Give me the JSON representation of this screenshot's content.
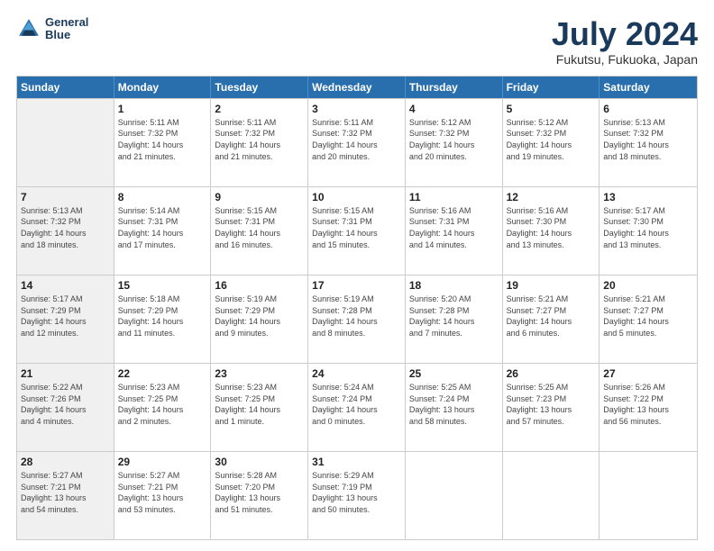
{
  "logo": {
    "line1": "General",
    "line2": "Blue"
  },
  "title": "July 2024",
  "subtitle": "Fukutsu, Fukuoka, Japan",
  "calendar": {
    "headers": [
      "Sunday",
      "Monday",
      "Tuesday",
      "Wednesday",
      "Thursday",
      "Friday",
      "Saturday"
    ],
    "rows": [
      [
        {
          "day": "",
          "info": "",
          "shaded": true
        },
        {
          "day": "1",
          "info": "Sunrise: 5:11 AM\nSunset: 7:32 PM\nDaylight: 14 hours\nand 21 minutes.",
          "shaded": false
        },
        {
          "day": "2",
          "info": "Sunrise: 5:11 AM\nSunset: 7:32 PM\nDaylight: 14 hours\nand 21 minutes.",
          "shaded": false
        },
        {
          "day": "3",
          "info": "Sunrise: 5:11 AM\nSunset: 7:32 PM\nDaylight: 14 hours\nand 20 minutes.",
          "shaded": false
        },
        {
          "day": "4",
          "info": "Sunrise: 5:12 AM\nSunset: 7:32 PM\nDaylight: 14 hours\nand 20 minutes.",
          "shaded": false
        },
        {
          "day": "5",
          "info": "Sunrise: 5:12 AM\nSunset: 7:32 PM\nDaylight: 14 hours\nand 19 minutes.",
          "shaded": false
        },
        {
          "day": "6",
          "info": "Sunrise: 5:13 AM\nSunset: 7:32 PM\nDaylight: 14 hours\nand 18 minutes.",
          "shaded": false
        }
      ],
      [
        {
          "day": "7",
          "info": "Sunrise: 5:13 AM\nSunset: 7:32 PM\nDaylight: 14 hours\nand 18 minutes.",
          "shaded": true
        },
        {
          "day": "8",
          "info": "Sunrise: 5:14 AM\nSunset: 7:31 PM\nDaylight: 14 hours\nand 17 minutes.",
          "shaded": false
        },
        {
          "day": "9",
          "info": "Sunrise: 5:15 AM\nSunset: 7:31 PM\nDaylight: 14 hours\nand 16 minutes.",
          "shaded": false
        },
        {
          "day": "10",
          "info": "Sunrise: 5:15 AM\nSunset: 7:31 PM\nDaylight: 14 hours\nand 15 minutes.",
          "shaded": false
        },
        {
          "day": "11",
          "info": "Sunrise: 5:16 AM\nSunset: 7:31 PM\nDaylight: 14 hours\nand 14 minutes.",
          "shaded": false
        },
        {
          "day": "12",
          "info": "Sunrise: 5:16 AM\nSunset: 7:30 PM\nDaylight: 14 hours\nand 13 minutes.",
          "shaded": false
        },
        {
          "day": "13",
          "info": "Sunrise: 5:17 AM\nSunset: 7:30 PM\nDaylight: 14 hours\nand 13 minutes.",
          "shaded": false
        }
      ],
      [
        {
          "day": "14",
          "info": "Sunrise: 5:17 AM\nSunset: 7:29 PM\nDaylight: 14 hours\nand 12 minutes.",
          "shaded": true
        },
        {
          "day": "15",
          "info": "Sunrise: 5:18 AM\nSunset: 7:29 PM\nDaylight: 14 hours\nand 11 minutes.",
          "shaded": false
        },
        {
          "day": "16",
          "info": "Sunrise: 5:19 AM\nSunset: 7:29 PM\nDaylight: 14 hours\nand 9 minutes.",
          "shaded": false
        },
        {
          "day": "17",
          "info": "Sunrise: 5:19 AM\nSunset: 7:28 PM\nDaylight: 14 hours\nand 8 minutes.",
          "shaded": false
        },
        {
          "day": "18",
          "info": "Sunrise: 5:20 AM\nSunset: 7:28 PM\nDaylight: 14 hours\nand 7 minutes.",
          "shaded": false
        },
        {
          "day": "19",
          "info": "Sunrise: 5:21 AM\nSunset: 7:27 PM\nDaylight: 14 hours\nand 6 minutes.",
          "shaded": false
        },
        {
          "day": "20",
          "info": "Sunrise: 5:21 AM\nSunset: 7:27 PM\nDaylight: 14 hours\nand 5 minutes.",
          "shaded": false
        }
      ],
      [
        {
          "day": "21",
          "info": "Sunrise: 5:22 AM\nSunset: 7:26 PM\nDaylight: 14 hours\nand 4 minutes.",
          "shaded": true
        },
        {
          "day": "22",
          "info": "Sunrise: 5:23 AM\nSunset: 7:25 PM\nDaylight: 14 hours\nand 2 minutes.",
          "shaded": false
        },
        {
          "day": "23",
          "info": "Sunrise: 5:23 AM\nSunset: 7:25 PM\nDaylight: 14 hours\nand 1 minute.",
          "shaded": false
        },
        {
          "day": "24",
          "info": "Sunrise: 5:24 AM\nSunset: 7:24 PM\nDaylight: 14 hours\nand 0 minutes.",
          "shaded": false
        },
        {
          "day": "25",
          "info": "Sunrise: 5:25 AM\nSunset: 7:24 PM\nDaylight: 13 hours\nand 58 minutes.",
          "shaded": false
        },
        {
          "day": "26",
          "info": "Sunrise: 5:25 AM\nSunset: 7:23 PM\nDaylight: 13 hours\nand 57 minutes.",
          "shaded": false
        },
        {
          "day": "27",
          "info": "Sunrise: 5:26 AM\nSunset: 7:22 PM\nDaylight: 13 hours\nand 56 minutes.",
          "shaded": false
        }
      ],
      [
        {
          "day": "28",
          "info": "Sunrise: 5:27 AM\nSunset: 7:21 PM\nDaylight: 13 hours\nand 54 minutes.",
          "shaded": true
        },
        {
          "day": "29",
          "info": "Sunrise: 5:27 AM\nSunset: 7:21 PM\nDaylight: 13 hours\nand 53 minutes.",
          "shaded": false
        },
        {
          "day": "30",
          "info": "Sunrise: 5:28 AM\nSunset: 7:20 PM\nDaylight: 13 hours\nand 51 minutes.",
          "shaded": false
        },
        {
          "day": "31",
          "info": "Sunrise: 5:29 AM\nSunset: 7:19 PM\nDaylight: 13 hours\nand 50 minutes.",
          "shaded": false
        },
        {
          "day": "",
          "info": "",
          "shaded": false
        },
        {
          "day": "",
          "info": "",
          "shaded": false
        },
        {
          "day": "",
          "info": "",
          "shaded": false
        }
      ]
    ]
  }
}
